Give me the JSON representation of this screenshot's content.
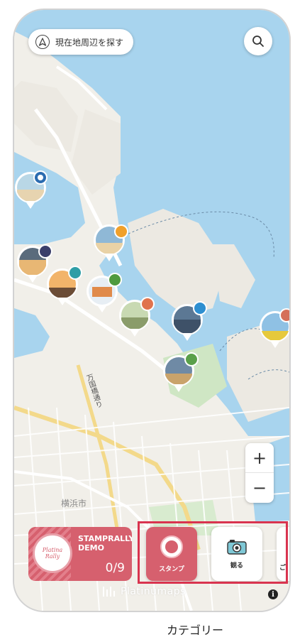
{
  "map": {
    "search_area_label": "現在地周辺を探す",
    "zoom_in_label": "+",
    "zoom_out_label": "−",
    "street_label": "万国橋通り",
    "district_label": "横浜市"
  },
  "stamp_rally": {
    "badge_text": "Platina Rally",
    "title_line1": "STAMPRALLY",
    "title_line2": "DEMO",
    "progress": "0/9"
  },
  "categories": [
    {
      "label": "スタンプ",
      "icon": "stamp-badge-icon",
      "active": true
    },
    {
      "label": "観る",
      "icon": "camera-icon",
      "active": false
    },
    {
      "label": "ご",
      "icon": "partial-icon",
      "active": false
    }
  ],
  "footer": {
    "brand": "Platinumaps",
    "info": "i"
  },
  "caption": "カテゴリー",
  "colors": {
    "accent": "#d6606e",
    "highlight": "#d9344f",
    "water": "#a8d4ee",
    "land": "#f1efe9"
  }
}
